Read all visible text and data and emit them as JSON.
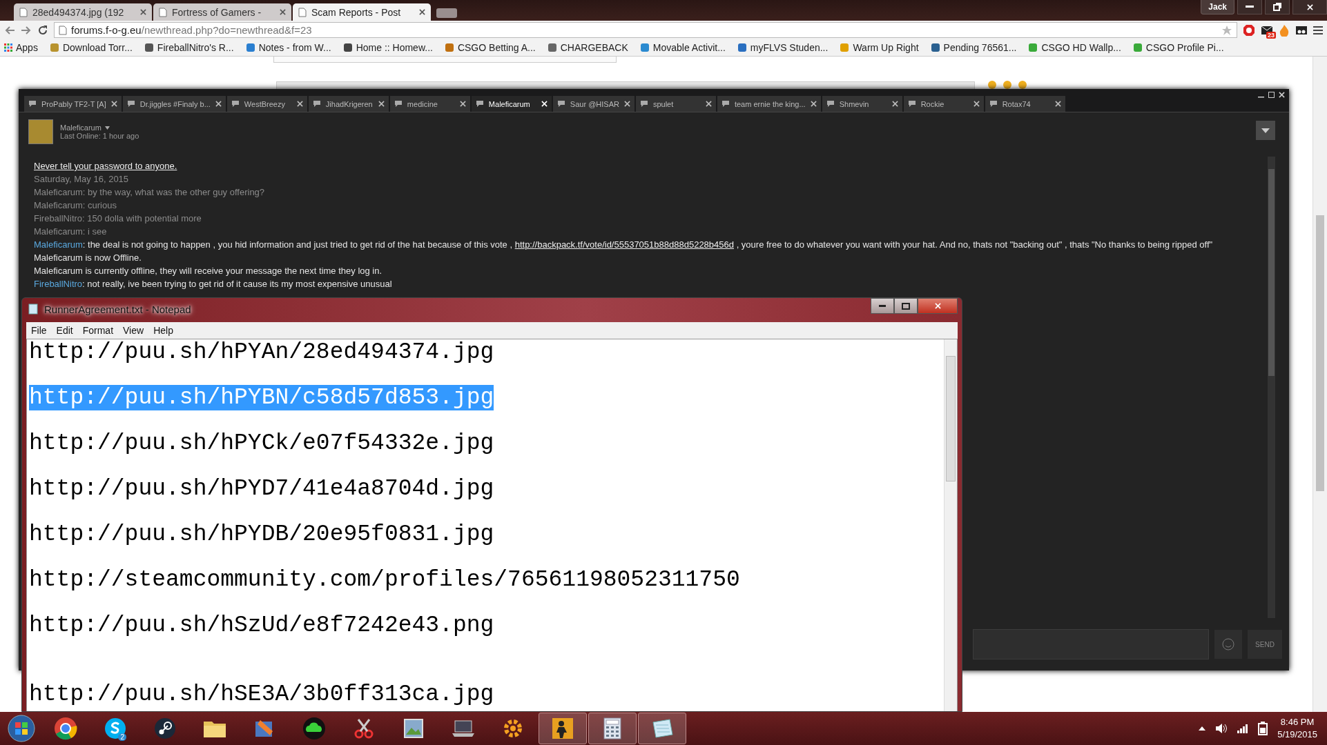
{
  "browser": {
    "tabs": [
      {
        "title": "28ed494374.jpg (192",
        "selected": false
      },
      {
        "title": "Fortress of Gamers -",
        "selected": false
      },
      {
        "title": "Scam Reports - Post",
        "selected": true
      }
    ],
    "profile": "Jack",
    "address": {
      "host": "forums.f-o-g.eu",
      "path": "/newthread.php?do=newthread&f=23"
    },
    "extension_badge": "23",
    "bookmarks": [
      "Apps",
      "Download Torr...",
      "FireballNitro's R...",
      "Notes - from W...",
      "Home :: Homew...",
      "CSGO Betting A...",
      "CHARGEBACK",
      "Movable Activit...",
      "myFLVS Studen...",
      "Warm Up Right",
      "Pending 76561...",
      "CSGO HD Wallp...",
      "CSGO Profile Pi..."
    ]
  },
  "chat": {
    "tabs": [
      {
        "name": "ProPably TF2-T [A]",
        "selected": false
      },
      {
        "name": "Dr.jiggles #Finaly b...",
        "selected": false
      },
      {
        "name": "WestBreezy",
        "selected": false
      },
      {
        "name": "JihadKrigeren",
        "selected": false
      },
      {
        "name": "medicine",
        "selected": false
      },
      {
        "name": "Maleficarum",
        "selected": true
      },
      {
        "name": "Saur @HISAR",
        "selected": false
      },
      {
        "name": "spulet",
        "selected": false
      },
      {
        "name": "team ernie the king...",
        "selected": false
      },
      {
        "name": "Shmevin",
        "selected": false
      },
      {
        "name": "Rockie",
        "selected": false
      },
      {
        "name": "Rotax74",
        "selected": false
      }
    ],
    "friend": {
      "name": "Maleficarum",
      "status": "Last Online: 1 hour ago"
    },
    "messages": [
      {
        "kind": "notice",
        "text": "Never tell your password to anyone."
      },
      {
        "kind": "date",
        "text": "Saturday, May 16, 2015"
      },
      {
        "kind": "history",
        "text": "Maleficarum: by the way, what was the other guy offering?"
      },
      {
        "kind": "history",
        "text": "Maleficarum: curious"
      },
      {
        "kind": "history",
        "text": "FireballNitro: 150 dolla with potential more"
      },
      {
        "kind": "history",
        "text": "Maleficarum: i see"
      },
      {
        "kind": "message",
        "sender": "Maleficarum",
        "text": ": the deal is not going to happen , you hid information and just tried to get rid of the hat because of this vote ,",
        "link": "http://backpack.tf/vote/id/55537051b88d88d5228b456d",
        "after": ", youre free to do whatever you want with your hat. And no, thats not \"backing out\" , thats \"No thanks to being ripped off\""
      },
      {
        "kind": "system",
        "text": "Maleficarum is now Offline."
      },
      {
        "kind": "system",
        "text": "Maleficarum is currently offline, they will receive your message the next time they log in."
      },
      {
        "kind": "message",
        "sender": "FireballNitro",
        "text": ": not really, ive been trying to get rid of it cause its my most expensive unusual"
      }
    ],
    "send": "SEND"
  },
  "notepad": {
    "title": "RunnerAgreement.txt - Notepad",
    "menu": [
      "File",
      "Edit",
      "Format",
      "View",
      "Help"
    ],
    "lines": [
      {
        "text": "http://puu.sh/hPYAn/28ed494374.jpg",
        "selected": false,
        "extra_gap_before": false
      },
      {
        "text": "http://puu.sh/hPYBN/c58d57d853.jpg",
        "selected": true,
        "extra_gap_before": false
      },
      {
        "text": "http://puu.sh/hPYCk/e07f54332e.jpg",
        "selected": false,
        "extra_gap_before": false
      },
      {
        "text": "http://puu.sh/hPYD7/41e4a8704d.jpg",
        "selected": false,
        "extra_gap_before": false
      },
      {
        "text": "http://puu.sh/hPYDB/20e95f0831.jpg",
        "selected": false,
        "extra_gap_before": false
      },
      {
        "text": "http://steamcommunity.com/profiles/76561198052311750",
        "selected": false,
        "extra_gap_before": false
      },
      {
        "text": "http://puu.sh/hSzUd/e8f7242e43.png",
        "selected": false,
        "extra_gap_before": false
      },
      {
        "text": "http://puu.sh/hSE3A/3b0ff313ca.jpg",
        "selected": false,
        "extra_gap_before": true
      }
    ]
  },
  "taskbar": {
    "apps": [
      {
        "kind": "chrome",
        "running": false
      },
      {
        "kind": "skype",
        "running": false,
        "badge": "2"
      },
      {
        "kind": "steam",
        "running": false
      },
      {
        "kind": "folder",
        "running": false
      },
      {
        "kind": "paint",
        "running": false
      },
      {
        "kind": "cloud",
        "running": false
      },
      {
        "kind": "scissors",
        "running": false
      },
      {
        "kind": "picture",
        "running": false
      },
      {
        "kind": "laptop",
        "running": false
      },
      {
        "kind": "gear",
        "running": false
      },
      {
        "kind": "game",
        "running": true
      },
      {
        "kind": "calculator",
        "running": true
      },
      {
        "kind": "notepad",
        "running": true
      }
    ],
    "time": "8:46 PM",
    "date": "5/19/2015"
  }
}
